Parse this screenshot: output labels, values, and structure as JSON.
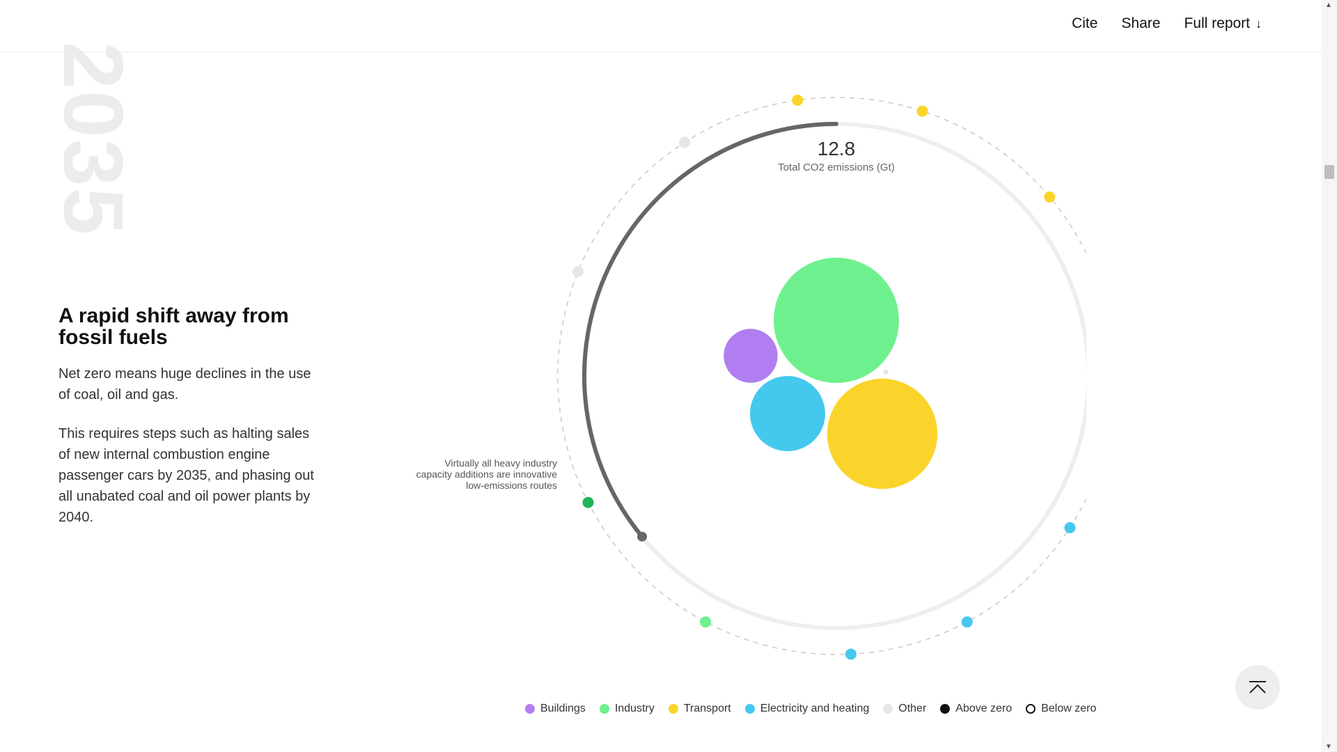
{
  "nav": {
    "cite": "Cite",
    "share": "Share",
    "full_report": "Full report"
  },
  "year_watermark": "2035",
  "story": {
    "heading": "A rapid shift away from fossil fuels",
    "paragraph1": "Net zero means huge declines in the use of coal, oil and gas.",
    "paragraph2": "This requires steps such as halting sales of new internal combustion engine passenger cars by 2035, and phasing out all unabated coal and oil power plants by 2040."
  },
  "chart_data": {
    "type": "bubble",
    "total_value": "12.8",
    "total_label": "Total CO2 emissions (Gt)",
    "progress_fraction": 0.36,
    "annotation": "Virtually all heavy industry capacity additions are innovative low-emissions routes",
    "bubbles": [
      {
        "sector": "Industry",
        "color": "#6ff08e",
        "relative_size": 1.0
      },
      {
        "sector": "Transport",
        "color": "#fad42a",
        "relative_size": 0.88
      },
      {
        "sector": "Electricity and heating",
        "color": "#45c8ee",
        "relative_size": 0.6
      },
      {
        "sector": "Buildings",
        "color": "#b07ef0",
        "relative_size": 0.43
      },
      {
        "sector": "Other",
        "color": "#e6e6e6",
        "relative_size": 0.04
      }
    ],
    "milestones": [
      {
        "sector": "Transport",
        "color": "#fad42a"
      },
      {
        "sector": "Transport",
        "color": "#fad42a"
      },
      {
        "sector": "Transport",
        "color": "#fad42a"
      },
      {
        "sector": "Buildings",
        "color": "#b07ef0"
      },
      {
        "sector": "Electricity and heating",
        "color": "#45c8ee"
      },
      {
        "sector": "Electricity and heating",
        "color": "#45c8ee"
      },
      {
        "sector": "Electricity and heating",
        "color": "#45c8ee"
      },
      {
        "sector": "Industry",
        "color": "#6ff08e"
      },
      {
        "sector": "Industry",
        "color": "#1fb45a"
      },
      {
        "sector": "Other",
        "color": "#e6e6e6"
      },
      {
        "sector": "Other",
        "color": "#e6e6e6"
      }
    ],
    "legend": [
      {
        "label": "Buildings",
        "color": "#b07ef0",
        "style": "fill"
      },
      {
        "label": "Industry",
        "color": "#6ff08e",
        "style": "fill"
      },
      {
        "label": "Transport",
        "color": "#fad42a",
        "style": "fill"
      },
      {
        "label": "Electricity and heating",
        "color": "#45c8ee",
        "style": "fill"
      },
      {
        "label": "Other",
        "color": "#e6e6e6",
        "style": "fill"
      },
      {
        "label": "Above zero",
        "color": "#111111",
        "style": "fill"
      },
      {
        "label": "Below zero",
        "color": "#111111",
        "style": "outline"
      }
    ]
  }
}
